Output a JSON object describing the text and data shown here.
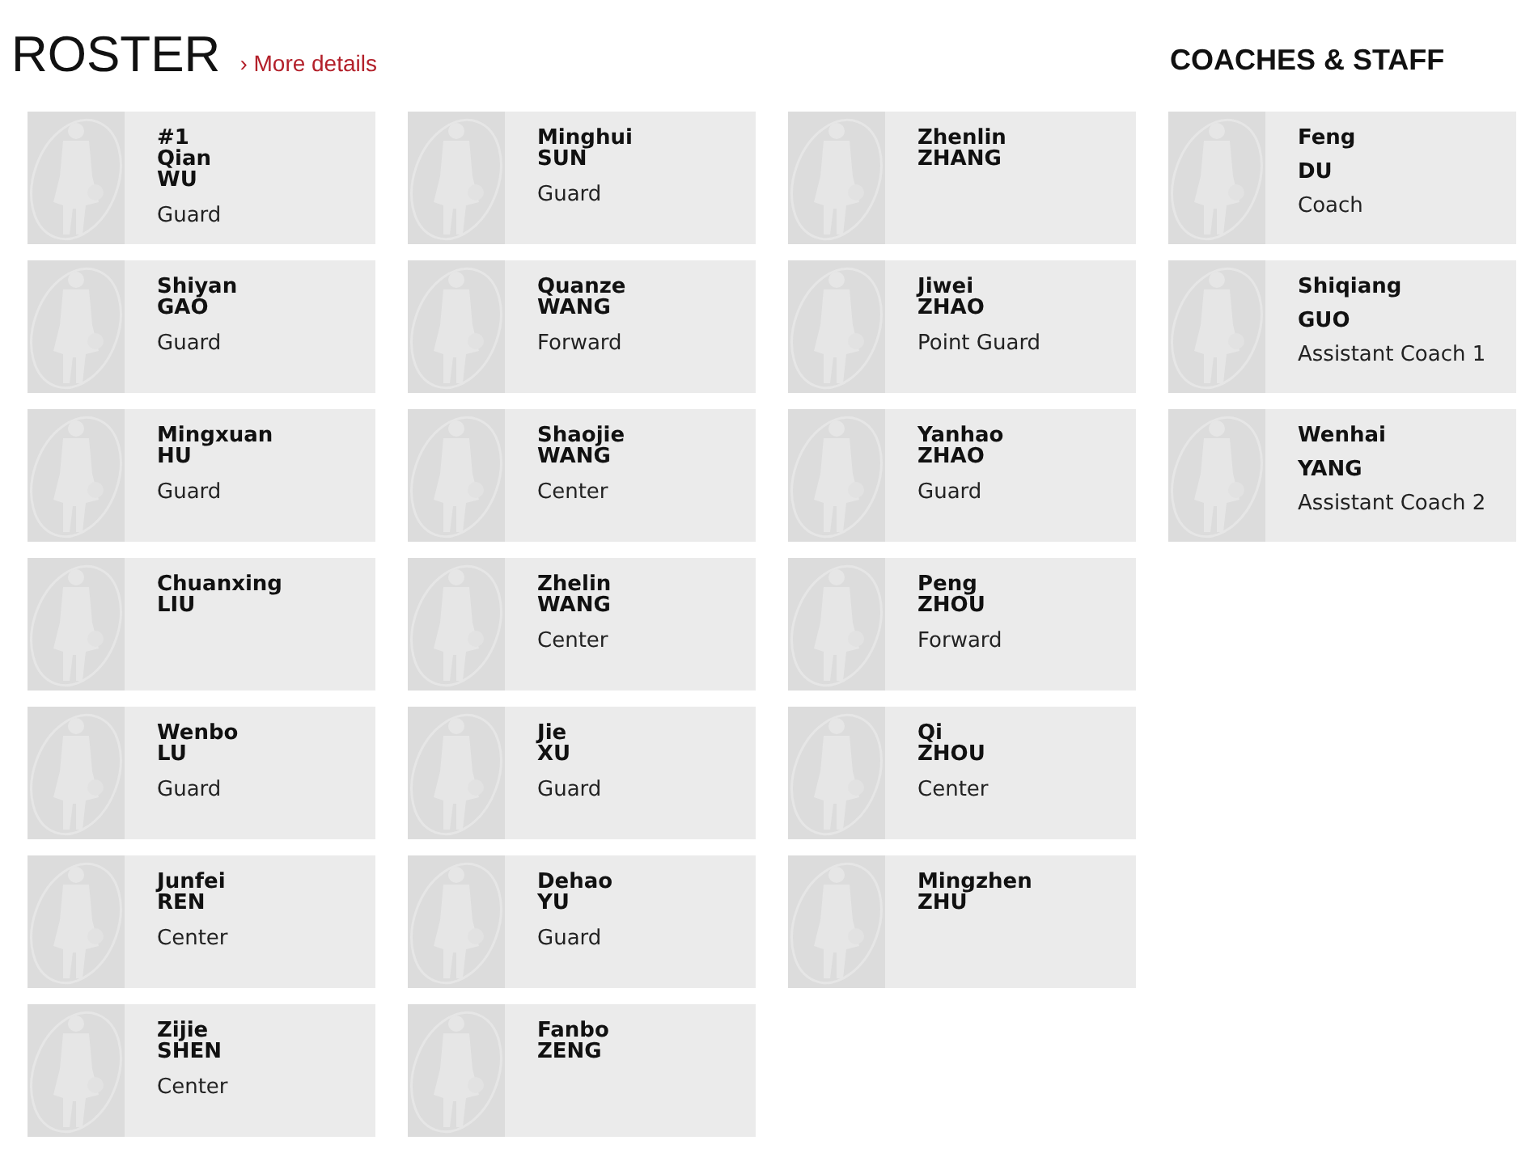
{
  "roster": {
    "title": "ROSTER",
    "more_link": "› More details",
    "columns": [
      [
        {
          "number": "#1",
          "first": "Qian",
          "last": "WU",
          "position": "Guard"
        },
        {
          "first": "Shiyan",
          "last": "GAO",
          "position": "Guard"
        },
        {
          "first": "Mingxuan",
          "last": "HU",
          "position": "Guard"
        },
        {
          "first": "Chuanxing",
          "last": "LIU"
        },
        {
          "first": "Wenbo",
          "last": "LU",
          "position": "Guard"
        },
        {
          "first": "Junfei",
          "last": "REN",
          "position": "Center"
        },
        {
          "first": "Zijie",
          "last": "SHEN",
          "position": "Center"
        }
      ],
      [
        {
          "first": "Minghui",
          "last": "SUN",
          "position": "Guard"
        },
        {
          "first": "Quanze",
          "last": "WANG",
          "position": "Forward"
        },
        {
          "first": "Shaojie",
          "last": "WANG",
          "position": "Center"
        },
        {
          "first": "Zhelin",
          "last": "WANG",
          "position": "Center"
        },
        {
          "first": "Jie",
          "last": "XU",
          "position": "Guard"
        },
        {
          "first": "Dehao",
          "last": "YU",
          "position": "Guard"
        },
        {
          "first": "Fanbo",
          "last": "ZENG"
        }
      ],
      [
        {
          "first": "Zhenlin",
          "last": "ZHANG"
        },
        {
          "first": "Jiwei",
          "last": "ZHAO",
          "position": "Point Guard"
        },
        {
          "first": "Yanhao",
          "last": "ZHAO",
          "position": "Guard"
        },
        {
          "first": "Peng",
          "last": "ZHOU",
          "position": "Forward"
        },
        {
          "first": "Qi",
          "last": "ZHOU",
          "position": "Center"
        },
        {
          "first": "Mingzhen",
          "last": "ZHU"
        }
      ]
    ]
  },
  "staff": {
    "title": "COACHES & STAFF",
    "members": [
      {
        "first": "Feng",
        "last": "DU",
        "role": "Coach"
      },
      {
        "first": "Shiqiang",
        "last": "GUO",
        "role": "Assistant Coach 1"
      },
      {
        "first": "Wenhai",
        "last": "YANG",
        "role": "Assistant Coach 2"
      }
    ]
  }
}
